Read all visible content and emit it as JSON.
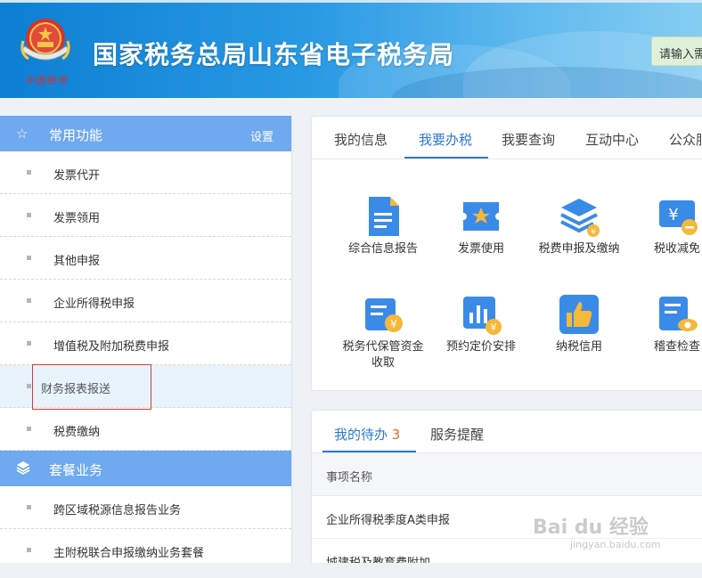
{
  "header": {
    "title": "国家税务总局山东省电子税务局",
    "emblem_caption": "中国税务",
    "search_placeholder": "请输入需"
  },
  "sidebar": {
    "groups": [
      {
        "title": "常用功能",
        "icon": "star-icon",
        "setting_label": "设置",
        "items": [
          {
            "label": "发票代开"
          },
          {
            "label": "发票领用"
          },
          {
            "label": "其他申报"
          },
          {
            "label": "企业所得税申报"
          },
          {
            "label": "增值税及附加税费申报"
          },
          {
            "label": "财务报表报送"
          },
          {
            "label": "税费缴纳"
          }
        ]
      },
      {
        "title": "套餐业务",
        "icon": "layers-icon",
        "items": [
          {
            "label": "跨区域税源信息报告业务"
          },
          {
            "label": "主附税联合申报缴纳业务套餐"
          }
        ]
      }
    ]
  },
  "main_tabs": [
    {
      "label": "我的信息"
    },
    {
      "label": "我要办税"
    },
    {
      "label": "我要查询"
    },
    {
      "label": "互动中心"
    },
    {
      "label": "公众服"
    }
  ],
  "services": [
    {
      "label": "综合信息报告",
      "icon": "document-icon"
    },
    {
      "label": "发票使用",
      "icon": "invoice-ticket-icon"
    },
    {
      "label": "税费申报及缴纳",
      "icon": "stack-yuan-icon"
    },
    {
      "label": "税收减免",
      "icon": "tax-reduction-icon"
    },
    {
      "label": "税务代保管资金收取",
      "icon": "custody-funds-icon"
    },
    {
      "label": "预约定价安排",
      "icon": "pricing-chart-icon"
    },
    {
      "label": "纳税信用",
      "icon": "thumbs-up-icon"
    },
    {
      "label": "稽查检查",
      "icon": "inspection-eye-icon"
    }
  ],
  "todo": {
    "tab_label": "我的待办",
    "count": "3",
    "reminder_label": "服务提醒",
    "column_header": "事项名称",
    "rows": [
      {
        "name": "企业所得税季度A类申报"
      },
      {
        "name": "城建税及教育费附加"
      }
    ]
  },
  "watermark": {
    "text": "Bai du 经验",
    "sub": "jingyan.baidu.com"
  },
  "colors": {
    "accent": "#2b78d6",
    "sidebar_header": "#6fa9ef",
    "highlight": "#d9383a",
    "count": "#e66a1f"
  }
}
